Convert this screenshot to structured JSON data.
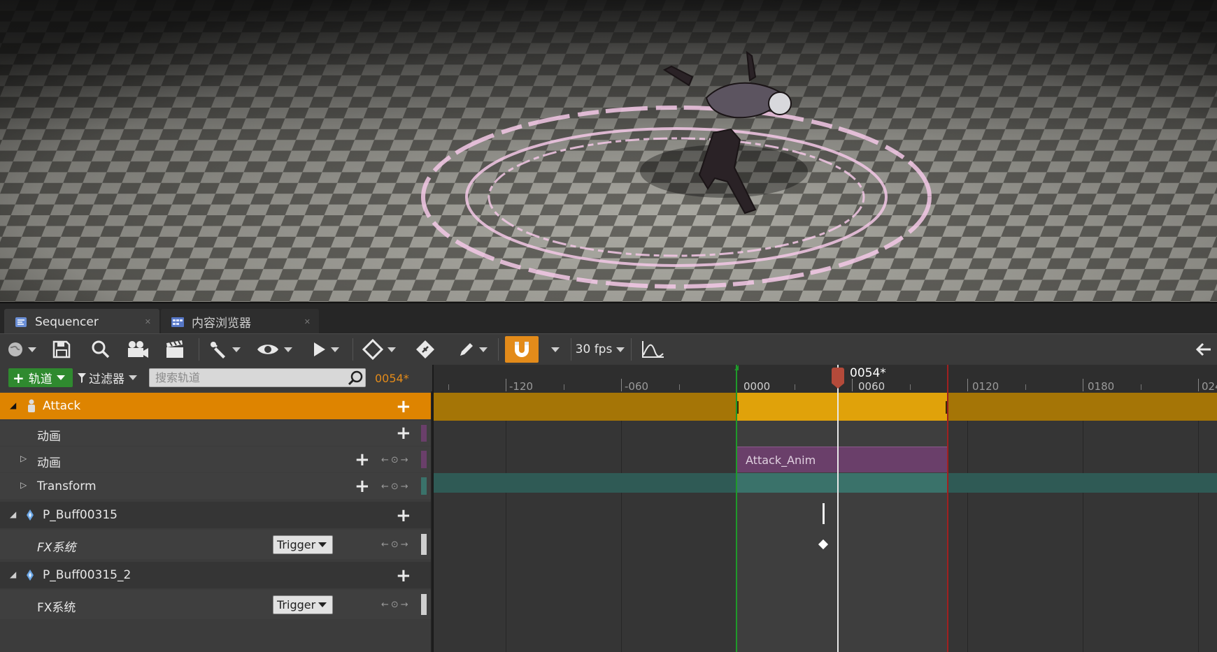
{
  "tabs": [
    {
      "label": "Sequencer",
      "icon": "sequencer-icon",
      "active": true
    },
    {
      "label": "内容浏览器",
      "icon": "content-browser-icon",
      "active": false
    }
  ],
  "toolbar": {
    "fps_label": "30 fps",
    "icons": [
      "world-icon",
      "save-icon",
      "search-icon",
      "camera-icon",
      "clapper-icon",
      "wrench-icon",
      "eye-icon",
      "play-icon",
      "key-icon",
      "key-all-icon",
      "pencil-icon",
      "snap-magnet-icon",
      "curve-icon",
      "back-arrow-icon"
    ]
  },
  "filter_bar": {
    "track_button_label": "轨道",
    "filter_label": "过滤器",
    "search_placeholder": "搜索轨道",
    "current_frame": "0054*"
  },
  "tree": {
    "rows": [
      {
        "label": "Attack",
        "type": "actor",
        "icon": "actor-icon",
        "selected": true
      },
      {
        "label": "动画",
        "type": "track"
      },
      {
        "label": "动画",
        "type": "track"
      },
      {
        "label": "Transform",
        "type": "track"
      },
      {
        "label": "P_Buff00315",
        "type": "actor",
        "icon": "particle-icon"
      },
      {
        "label": "FX系统",
        "type": "track",
        "dropdown": "Trigger"
      },
      {
        "label": "P_Buff00315_2",
        "type": "actor",
        "icon": "particle-icon"
      },
      {
        "label": "FX系统",
        "type": "track",
        "dropdown": "Trigger"
      }
    ]
  },
  "timeline": {
    "playhead_label": "0054*",
    "ruler_labels": [
      "-120",
      "-060",
      "0000",
      "0060",
      "0120",
      "0180",
      "024"
    ],
    "section_label": "Attack_Anim"
  },
  "colors": {
    "accent_orange": "#e38b1a",
    "selected_row": "#de8400",
    "section_gold": "#e0a20a",
    "section_dim": "#a57506",
    "anim_section": "#6a3f6a",
    "transform_section": "#3a726a"
  }
}
